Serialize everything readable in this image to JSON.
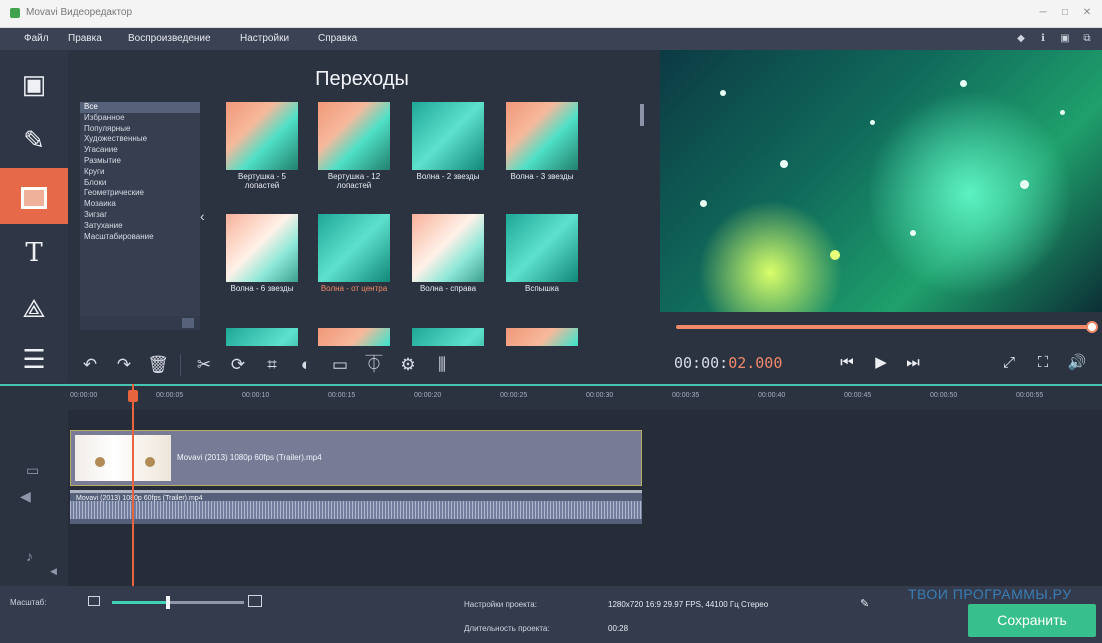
{
  "window": {
    "title": "Movavi Видеоредактор"
  },
  "menu": [
    "Файл",
    "Правка",
    "Воспроизведение",
    "Настройки",
    "Справка"
  ],
  "panel": {
    "title": "Переходы",
    "categories": [
      "Все",
      "Избранное",
      "Популярные",
      "Художественные",
      "Угасание",
      "Размытие",
      "Круги",
      "Блоки",
      "Геометрические",
      "Мозаика",
      "Зигзаг",
      "Затухание",
      "Масштабирование"
    ],
    "transitions": [
      {
        "label": "Вертушка - 5 лопастей"
      },
      {
        "label": "Вертушка - 12 лопастей"
      },
      {
        "label": "Волна - 2 звезды"
      },
      {
        "label": "Волна - 3 звезды"
      },
      {
        "label": "Волна - 6 звезды"
      },
      {
        "label": "Волна - от центра"
      },
      {
        "label": "Волна - справа"
      },
      {
        "label": "Вспышка"
      }
    ]
  },
  "playback": {
    "timecode_main": "00:00:",
    "timecode_accent": "02.000"
  },
  "ruler": [
    "00:00:00",
    "00:00:05",
    "00:00:10",
    "00:00:15",
    "00:00:20",
    "00:00:25",
    "00:00:30",
    "00:00:35",
    "00:00:40",
    "00:00:45",
    "00:00:50",
    "00:00:55"
  ],
  "timeline": {
    "video_clip_name": "Movavi (2013) 1080p 60fps (Trailer).mp4",
    "audio_clip_name": "Movavi (2013) 1080p 60fps (Trailer).mp4"
  },
  "bottom": {
    "zoom_label": "Масштаб:",
    "project_settings_label": "Настройки проекта:",
    "project_settings_value": "1280x720 16:9 29.97 FPS, 44100 Гц Стерео",
    "project_duration_label": "Длительность проекта:",
    "project_duration_value": "00:28",
    "watermark": "ТВОИ ПРОГРАММЫ.РУ",
    "save_label": "Сохранить"
  }
}
